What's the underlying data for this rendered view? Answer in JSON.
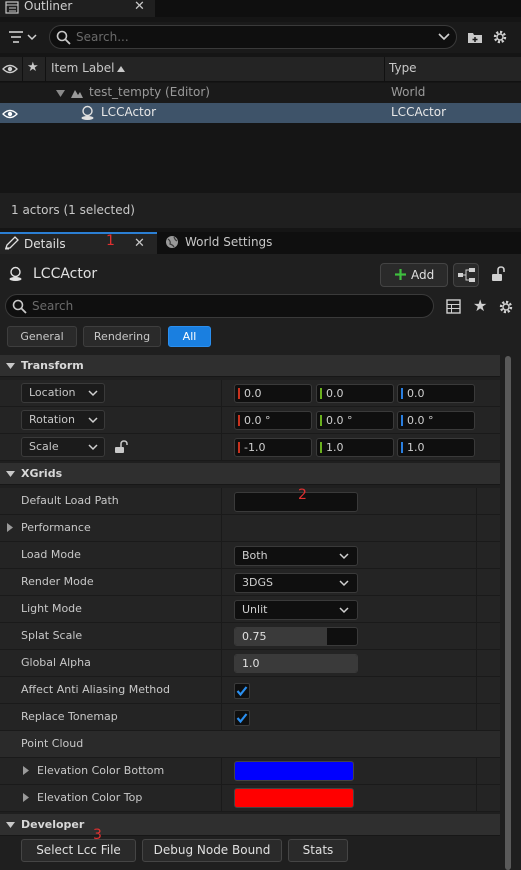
{
  "outliner": {
    "tab_title": "Outliner",
    "search_placeholder": "Search...",
    "columns": {
      "item_label": "Item Label",
      "type": "Type"
    },
    "rows": [
      {
        "label": "test_tempty (Editor)",
        "type": "World"
      },
      {
        "label": "LCCActor",
        "type": "LCCActor"
      }
    ],
    "status": "1 actors (1 selected)"
  },
  "details": {
    "tabs": [
      {
        "label": "Details"
      },
      {
        "label": "World Settings"
      }
    ],
    "actor_name": "LCCActor",
    "add_label": "Add",
    "search_placeholder": "Search",
    "filters": [
      "General",
      "Rendering",
      "All"
    ],
    "sections": {
      "transform": {
        "title": "Transform",
        "location": {
          "label": "Location",
          "x": "0.0",
          "y": "0.0",
          "z": "0.0"
        },
        "rotation": {
          "label": "Rotation",
          "x": "0.0 °",
          "y": "0.0 °",
          "z": "0.0 °"
        },
        "scale": {
          "label": "Scale",
          "x": "-1.0",
          "y": "1.0",
          "z": "1.0"
        }
      },
      "xgrids": {
        "title": "XGrids",
        "default_load_path": {
          "label": "Default Load Path",
          "value": ""
        },
        "performance": {
          "label": "Performance"
        },
        "load_mode": {
          "label": "Load Mode",
          "value": "Both"
        },
        "render_mode": {
          "label": "Render Mode",
          "value": "3DGS"
        },
        "light_mode": {
          "label": "Light Mode",
          "value": "Unlit"
        },
        "splat_scale": {
          "label": "Splat Scale",
          "value": "0.75"
        },
        "global_alpha": {
          "label": "Global Alpha",
          "value": "1.0"
        },
        "affect_aa": {
          "label": "Affect Anti Aliasing Method",
          "checked": true
        },
        "replace_tonemap": {
          "label": "Replace Tonemap",
          "checked": true
        }
      },
      "point_cloud": {
        "title": "Point Cloud",
        "elevation_bottom": {
          "label": "Elevation Color Bottom",
          "color": "#0000ff"
        },
        "elevation_top": {
          "label": "Elevation Color Top",
          "color": "#ff0000"
        }
      },
      "developer": {
        "title": "Developer",
        "buttons": [
          "Select Lcc File",
          "Debug Node Bound",
          "Stats"
        ]
      }
    }
  },
  "annotations": [
    "1",
    "2",
    "3"
  ],
  "colors": {
    "accent": "#1a7fe0",
    "selected_row": "#3e5369",
    "axis_x": "#c8321e",
    "axis_y": "#6ab01e",
    "axis_z": "#2a7fe0"
  }
}
